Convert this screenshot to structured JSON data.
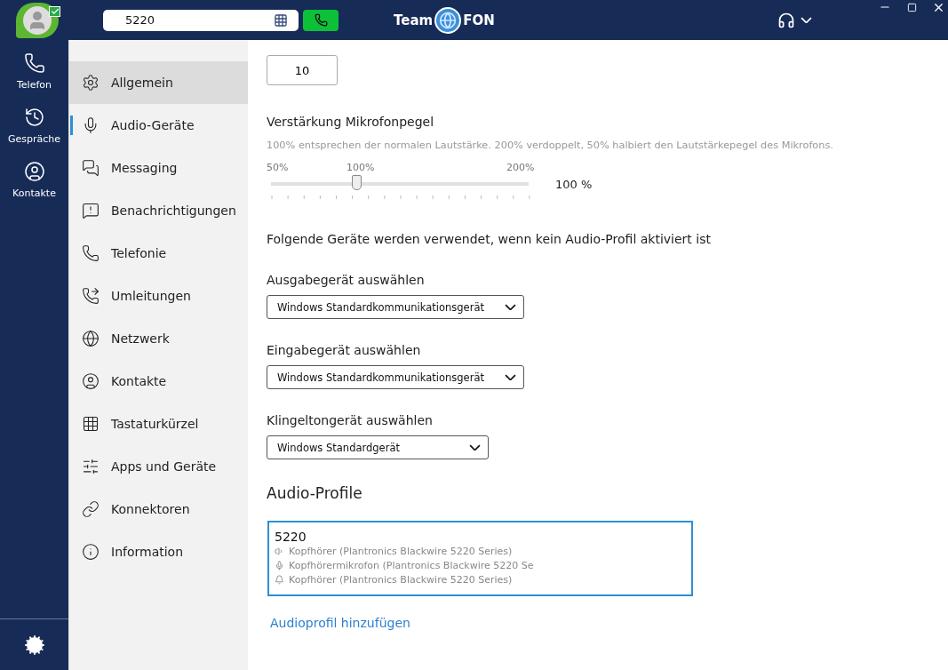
{
  "topbar": {
    "dial_value": "5220",
    "logo": {
      "left": "Team",
      "right": "FON"
    },
    "presence_checked": true
  },
  "rail": [
    {
      "label": "Telefon",
      "kind": "phone"
    },
    {
      "label": "Gespräche",
      "kind": "history"
    },
    {
      "label": "Kontakte",
      "kind": "contact"
    }
  ],
  "settings_nav": [
    {
      "label": "Allgemein",
      "kind": "gear",
      "hovered": true,
      "selected": false
    },
    {
      "label": "Audio-Geräte",
      "kind": "mic",
      "hovered": false,
      "selected": true
    },
    {
      "label": "Messaging",
      "kind": "chat",
      "hovered": false,
      "selected": false
    },
    {
      "label": "Benachrichtigungen",
      "kind": "alert",
      "hovered": false,
      "selected": false
    },
    {
      "label": "Telefonie",
      "kind": "phone",
      "hovered": false,
      "selected": false
    },
    {
      "label": "Umleitungen",
      "kind": "forward",
      "hovered": false,
      "selected": false
    },
    {
      "label": "Netzwerk",
      "kind": "globe",
      "hovered": false,
      "selected": false
    },
    {
      "label": "Kontakte",
      "kind": "contact",
      "hovered": false,
      "selected": false
    },
    {
      "label": "Tastaturkürzel",
      "kind": "keys",
      "hovered": false,
      "selected": false
    },
    {
      "label": "Apps und Geräte",
      "kind": "sliders",
      "hovered": false,
      "selected": false
    },
    {
      "label": "Konnektoren",
      "kind": "link",
      "hovered": false,
      "selected": false
    },
    {
      "label": "Information",
      "kind": "info",
      "hovered": false,
      "selected": false
    }
  ],
  "content": {
    "number_value": "10",
    "gain": {
      "title": "Verstärkung Mikrofonpegel",
      "description": "100% entsprechen der normalen Lautstärke. 200% verdoppelt, 50% halbiert den Lautstärkepegel des Mikrofons.",
      "scale": [
        "50%",
        "100%",
        "200%"
      ],
      "level": 0.33,
      "reading": "100 %"
    },
    "note": "Folgende Geräte werden verwendet, wenn kein Audio-Profil aktiviert ist",
    "devices": [
      {
        "label": "Ausgabegerät auswählen",
        "value": "Windows Standardkommunikationsgerät"
      },
      {
        "label": "Eingabegerät auswählen",
        "value": "Windows Standardkommunikationsgerät"
      },
      {
        "label": "Klingeltongerät auswählen",
        "value": "Windows Standardgerät"
      }
    ],
    "profiles_title": "Audio-Profile",
    "profiles": [
      {
        "name": "5220",
        "selected": true,
        "devices": [
          {
            "kind": "speaker",
            "text": "Kopfhörer (Plantronics Blackwire 5220 Series)"
          },
          {
            "kind": "mic",
            "text": "Kopfhörermikrofon (Plantronics Blackwire 5220 Se"
          },
          {
            "kind": "bell",
            "text": "Kopfhörer (Plantronics Blackwire 5220 Series)"
          }
        ]
      }
    ],
    "add_link": "Audioprofil hinzufügen"
  }
}
